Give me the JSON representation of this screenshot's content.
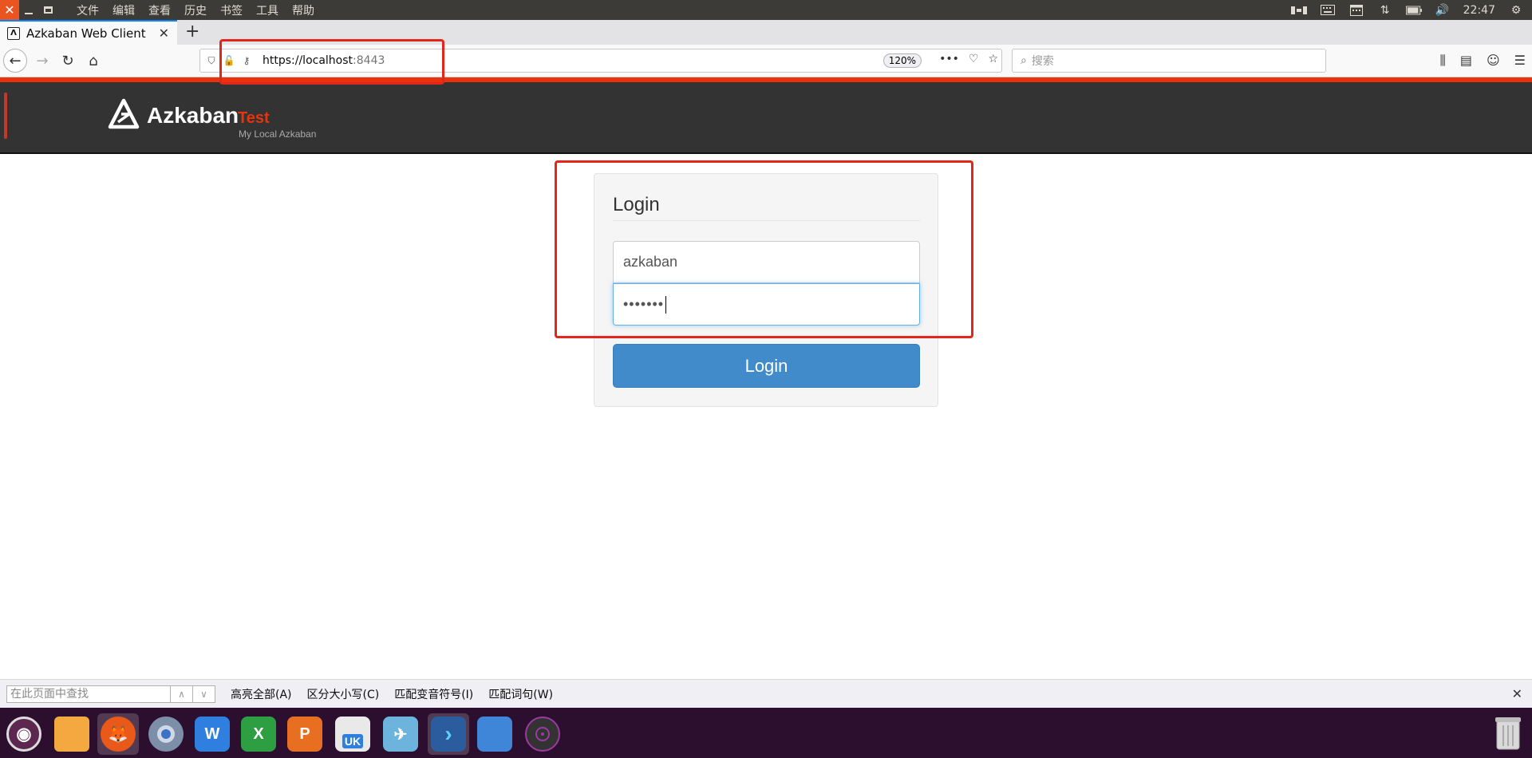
{
  "system": {
    "menu": [
      "文件",
      "编辑",
      "查看",
      "历史",
      "书签",
      "工具",
      "帮助"
    ],
    "clock": "22:47"
  },
  "browser": {
    "tab_title": "Azkaban Web Client",
    "url_host": "https://localhost",
    "url_port": ":8443",
    "zoom": "120%",
    "search_placeholder": "搜索"
  },
  "azkaban": {
    "name": "Azkaban",
    "env": "Test",
    "subtitle": "My Local Azkaban"
  },
  "login": {
    "title": "Login",
    "username": "azkaban",
    "password_mask": "•••••••",
    "button": "Login"
  },
  "findbar": {
    "placeholder": "在此页面中查找",
    "highlight_all": "高亮全部(A)",
    "match_case": "区分大小写(C)",
    "match_diacritics": "匹配变音符号(I)",
    "whole_words": "匹配词句(W)"
  },
  "dock": {
    "items": [
      "ubuntu-icon",
      "files-icon",
      "firefox-icon",
      "chromium-icon",
      "writer-icon",
      "calc-icon",
      "impress-icon",
      "software-center-icon",
      "screenshot-icon",
      "terminal-icon",
      "workspace-icon",
      "disk-icon"
    ],
    "wps_writer": "W",
    "wps_calc": "X",
    "wps_impress": "P",
    "uk": "UK"
  },
  "colors": {
    "accent_orange": "#e8330c",
    "header_bg": "#333333",
    "login_button": "#428bca",
    "annotation_red": "#e3261b"
  }
}
